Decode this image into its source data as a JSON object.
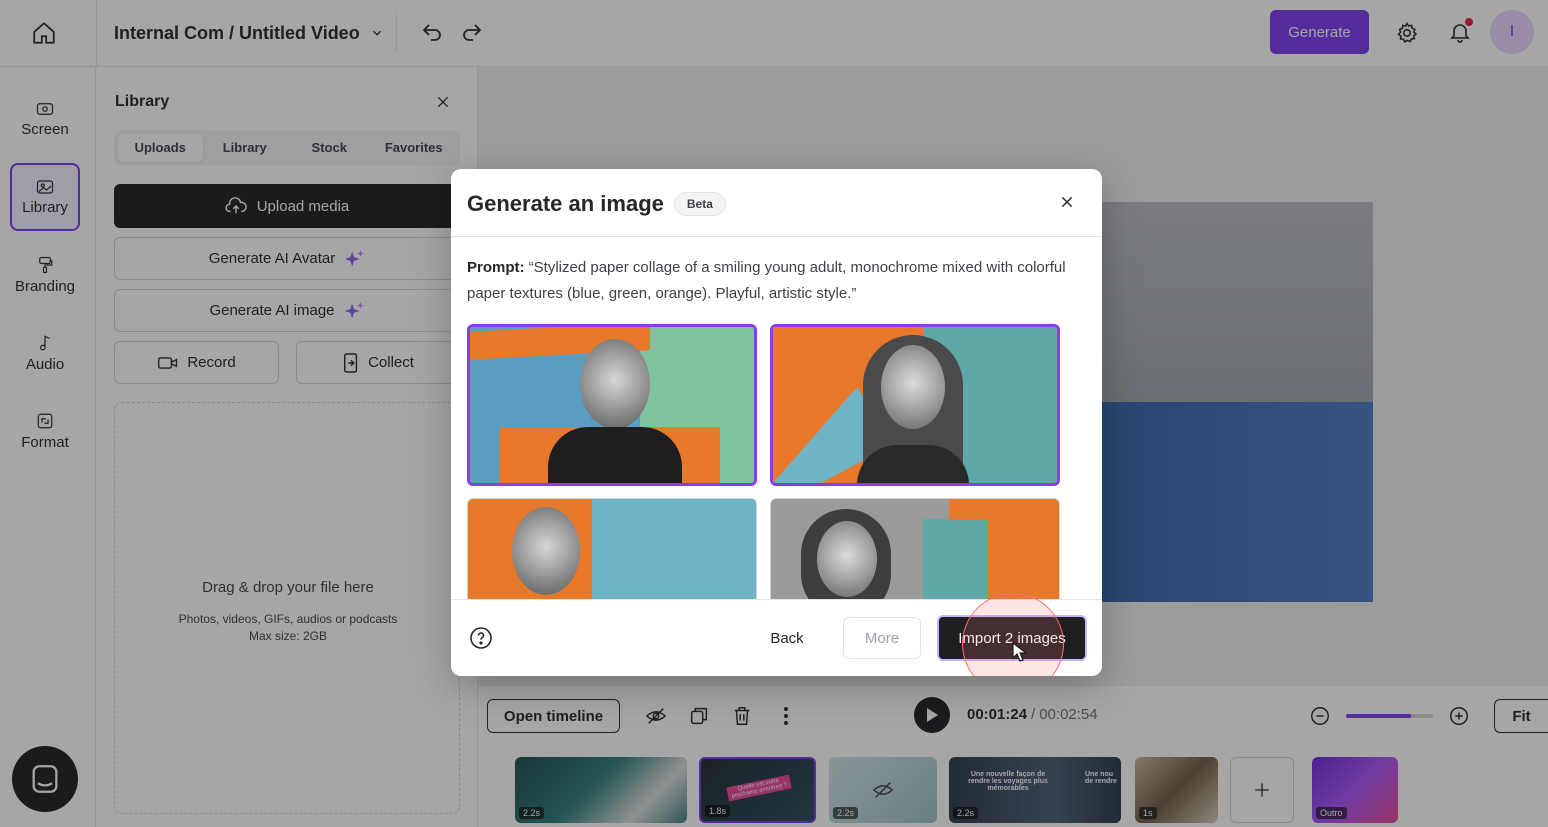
{
  "header": {
    "project": "Internal Com / Untitled Video",
    "generate_label": "Generate",
    "avatar_initial": "I"
  },
  "rail": {
    "items": [
      {
        "label": "Screen",
        "icon": "screen-icon"
      },
      {
        "label": "Library",
        "icon": "library-icon"
      },
      {
        "label": "Branding",
        "icon": "branding-icon"
      },
      {
        "label": "Audio",
        "icon": "audio-icon"
      },
      {
        "label": "Format",
        "icon": "format-icon"
      }
    ]
  },
  "library": {
    "title": "Library",
    "tabs": [
      "Uploads",
      "Library",
      "Stock",
      "Favorites"
    ],
    "upload_media": "Upload media",
    "generate_avatar": "Generate AI Avatar",
    "generate_image": "Generate AI image",
    "record": "Record",
    "collect": "Collect",
    "drop_title": "Drag & drop your file here",
    "drop_sub": "Photos, videos, GIFs, audios or podcasts",
    "drop_max": "Max size: 2GB"
  },
  "modal": {
    "title": "Generate an image",
    "badge": "Beta",
    "prompt_label": "Prompt:",
    "prompt_text": "“Stylized paper collage of a smiling young adult, monochrome mixed with colorful paper textures (blue, green, orange). Playful, artistic style.”",
    "back": "Back",
    "more": "More",
    "import": "Import 2 images"
  },
  "timeline": {
    "open_timeline": "Open timeline",
    "current_time": "00:01:24",
    "separator": "/",
    "total_time": "00:02:54",
    "fit": "Fit",
    "zoom_level": 0.75,
    "clips": [
      {
        "duration": "2.2s"
      },
      {
        "duration": "1.8s",
        "caption": "Quelle est votre prochaine aventure ?"
      },
      {
        "duration": "2.2s"
      },
      {
        "duration": "2.2s",
        "caption": "Une nouvelle façon de rendre les voyages plus mémorables",
        "caption2": "Une nou de rendre"
      },
      {
        "duration": "1s"
      },
      {
        "duration": "Outro"
      }
    ]
  },
  "colors": {
    "accent": "#7c3aed",
    "dark": "#1f1f22",
    "orange": "#e8782a",
    "teal": "#5fa8a8",
    "blue": "#5a9ec4",
    "green": "#7fc4a0"
  }
}
